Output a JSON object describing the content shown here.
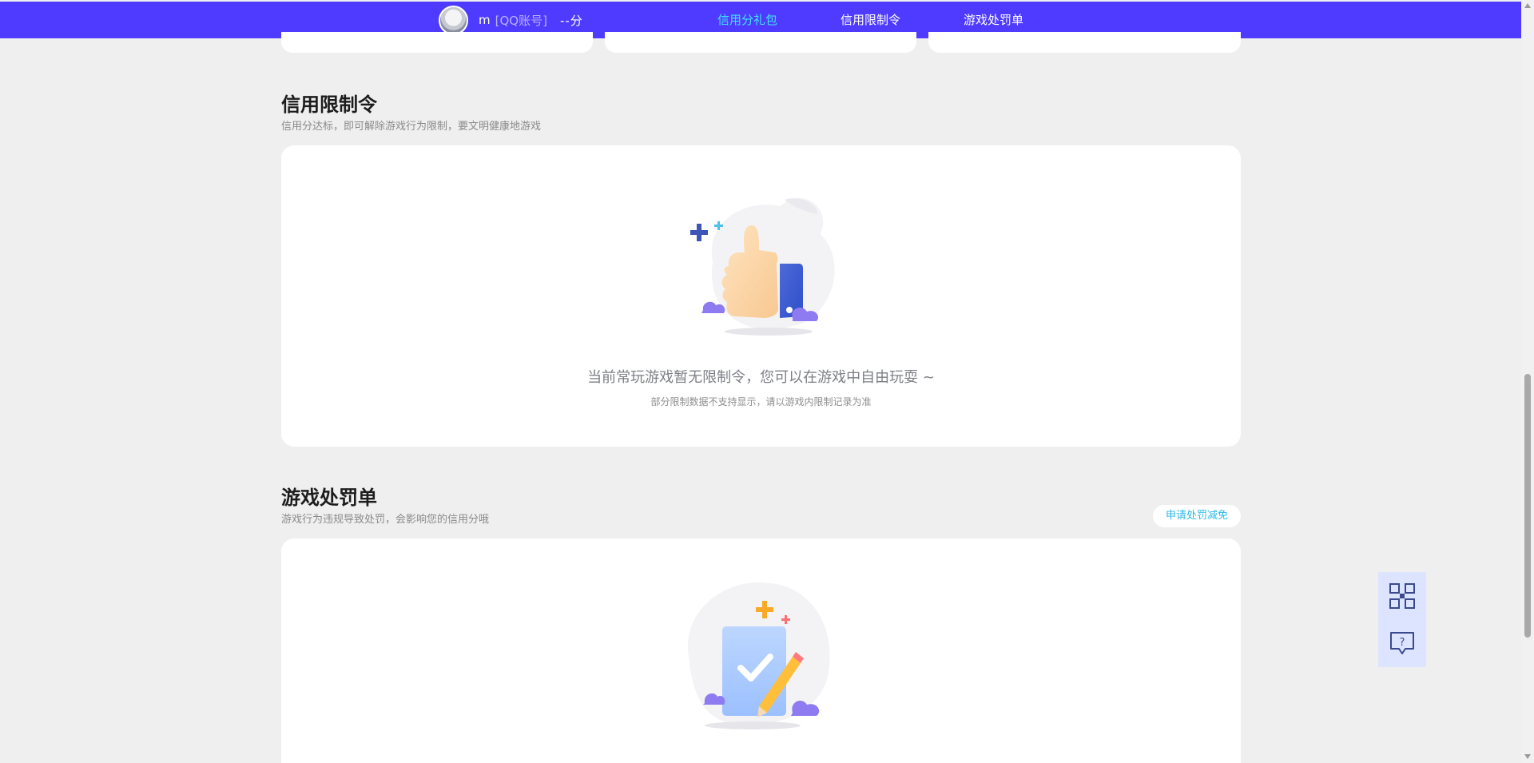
{
  "header": {
    "username": "m",
    "account_type": "[QQ账号]",
    "score": "--分",
    "tabs": [
      {
        "label": "信用分礼包",
        "active": true
      },
      {
        "label": "信用限制令",
        "active": false
      },
      {
        "label": "游戏处罚单",
        "active": false
      }
    ]
  },
  "restriction_section": {
    "title": "信用限制令",
    "subtitle": "信用分达标，即可解除游戏行为限制，要文明健康地游戏",
    "empty_main": "当前常玩游戏暂无限制令，您可以在游戏中自由玩耍 ~",
    "empty_sub": "部分限制数据不支持显示，请以游戏内限制记录为准",
    "illustration_icon": "thumbs-up-icon"
  },
  "penalty_section": {
    "title": "游戏处罚单",
    "subtitle": "游戏行为违规导致处罚，会影响您的信用分哦",
    "appeal_button": "申请处罚减免",
    "illustration_icon": "checklist-pencil-icon"
  },
  "floating_tools": {
    "items": [
      {
        "icon": "qr-code-icon"
      },
      {
        "icon": "help-chat-icon"
      }
    ]
  },
  "colors": {
    "header_bg": "#4f3bff",
    "tab_active": "#3ee6ff",
    "link": "#29b8e8",
    "page_bg": "#efefef"
  }
}
